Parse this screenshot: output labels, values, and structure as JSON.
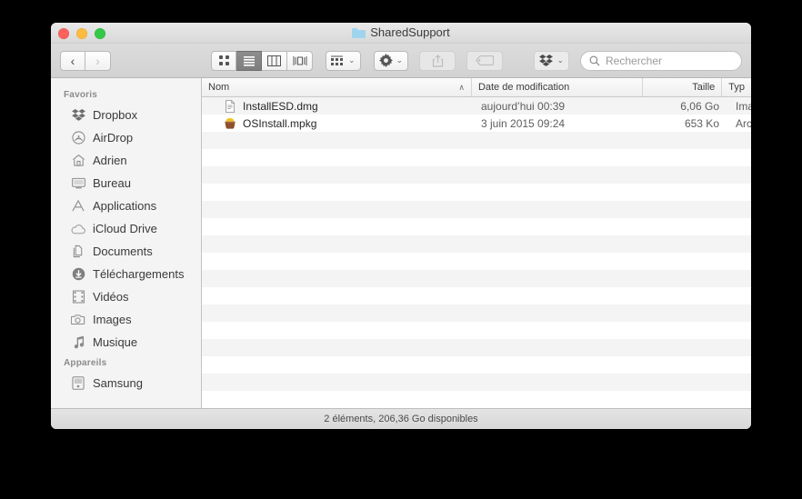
{
  "window": {
    "title": "SharedSupport",
    "title_icon": "folder-icon",
    "traffic_lights": [
      "close-button",
      "minimize-button",
      "zoom-button"
    ]
  },
  "toolbar": {
    "back_glyph": "‹",
    "forward_glyph": "›",
    "view_modes": [
      {
        "name": "icon-view",
        "active": false
      },
      {
        "name": "list-view",
        "active": true
      },
      {
        "name": "column-view",
        "active": false
      },
      {
        "name": "coverflow-view",
        "active": false
      }
    ],
    "arrange_icon": "arrange-icon",
    "action_icon": "gear-icon",
    "share_icon": "share-icon",
    "tag_icon": "tag-icon",
    "dropbox_icon": "dropbox-icon",
    "dropdown_chevron": "⌄",
    "search": {
      "placeholder": "Rechercher",
      "value": "",
      "icon": "search-icon"
    }
  },
  "sidebar": {
    "sections": [
      {
        "heading": "Favoris",
        "items": [
          {
            "label": "Dropbox",
            "icon": "dropbox-icon"
          },
          {
            "label": "AirDrop",
            "icon": "airdrop-icon"
          },
          {
            "label": "Adrien",
            "icon": "home-icon"
          },
          {
            "label": "Bureau",
            "icon": "desktop-icon"
          },
          {
            "label": "Applications",
            "icon": "applications-icon"
          },
          {
            "label": "iCloud Drive",
            "icon": "cloud-icon"
          },
          {
            "label": "Documents",
            "icon": "documents-icon"
          },
          {
            "label": "Téléchargements",
            "icon": "downloads-icon"
          },
          {
            "label": "Vidéos",
            "icon": "video-icon"
          },
          {
            "label": "Images",
            "icon": "camera-icon"
          },
          {
            "label": "Musique",
            "icon": "music-icon"
          }
        ]
      },
      {
        "heading": "Appareils",
        "items": [
          {
            "label": "Samsung",
            "icon": "harddisk-icon"
          }
        ]
      }
    ]
  },
  "file_list": {
    "columns": [
      {
        "key": "name",
        "label": "Nom",
        "sorted": "asc",
        "sort_glyph": "∧"
      },
      {
        "key": "date",
        "label": "Date de modification"
      },
      {
        "key": "size",
        "label": "Taille"
      },
      {
        "key": "type",
        "label": "Typ"
      }
    ],
    "rows": [
      {
        "name": "InstallESD.dmg",
        "date": "aujourd’hui 00:39",
        "size": "6,06 Go",
        "type": "Ima",
        "icon": "disk-image-icon"
      },
      {
        "name": "OSInstall.mpkg",
        "date": "3 juin 2015 09:24",
        "size": "653 Ko",
        "type": "Arc",
        "icon": "package-icon"
      }
    ],
    "empty_row_count": 16
  },
  "statusbar": {
    "text": "2 éléments, 206,36 Go disponibles"
  },
  "colors": {
    "window_bg": "#ffffff",
    "sidebar_bg": "#f4f4f4",
    "toolbar_bg": "#d6d6d6",
    "stripe": "#f4f4f4",
    "folder_blue": "#9fd4ef",
    "light_red": "#fc615d",
    "light_yellow": "#fdbc40",
    "light_green": "#34c84a"
  }
}
